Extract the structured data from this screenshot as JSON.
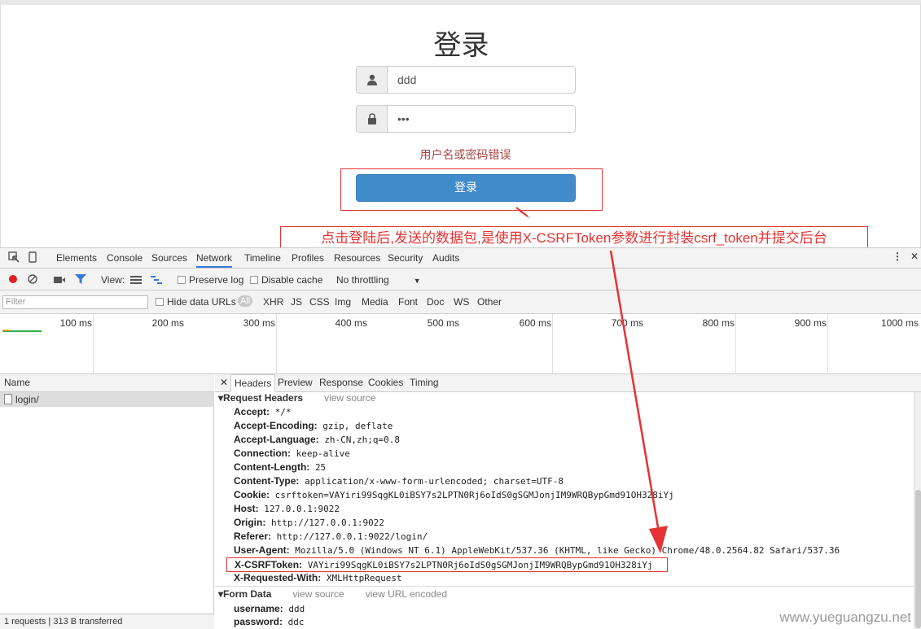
{
  "login": {
    "title": "登录",
    "username_value": "ddd",
    "password_value": "•••",
    "error": "用户名或密码错误",
    "submit_label": "登录"
  },
  "annotation": "点击登陆后,发送的数据包,是使用X-CSRFToken参数进行封装csrf_token并提交后台",
  "devtools": {
    "tabs": [
      "Elements",
      "Console",
      "Sources",
      "Network",
      "Timeline",
      "Profiles",
      "Resources",
      "Security",
      "Audits"
    ],
    "active_tab": "Network",
    "toolbar": {
      "view_label": "View:",
      "preserve_log": "Preserve log",
      "disable_cache": "Disable cache",
      "throttling": "No throttling"
    },
    "filter": {
      "placeholder": "Filter",
      "hide_data_urls": "Hide data URLs",
      "types": [
        "All",
        "XHR",
        "JS",
        "CSS",
        "Img",
        "Media",
        "Font",
        "Doc",
        "WS",
        "Other"
      ]
    },
    "timeline_labels": [
      "100 ms",
      "200 ms",
      "300 ms",
      "400 ms",
      "500 ms",
      "600 ms",
      "700 ms",
      "800 ms",
      "900 ms",
      "1000 ms"
    ],
    "name_header": "Name",
    "requests": [
      "login/"
    ],
    "status": "1 requests  |  313 B transferred",
    "detail_tabs": [
      "Headers",
      "Preview",
      "Response",
      "Cookies",
      "Timing"
    ],
    "request_headers_title": "Request Headers",
    "view_source": "view source",
    "headers": [
      {
        "k": "Accept:",
        "v": "*/*"
      },
      {
        "k": "Accept-Encoding:",
        "v": "gzip, deflate"
      },
      {
        "k": "Accept-Language:",
        "v": "zh-CN,zh;q=0.8"
      },
      {
        "k": "Connection:",
        "v": "keep-alive"
      },
      {
        "k": "Content-Length:",
        "v": "25"
      },
      {
        "k": "Content-Type:",
        "v": "application/x-www-form-urlencoded; charset=UTF-8"
      },
      {
        "k": "Cookie:",
        "v": "csrftoken=VAYiri99SqgKL0iBSY7s2LPTN0Rj6oIdS0gSGMJonjIM9WRQBypGmd91OH328iYj"
      },
      {
        "k": "Host:",
        "v": "127.0.0.1:9022"
      },
      {
        "k": "Origin:",
        "v": "http://127.0.0.1:9022"
      },
      {
        "k": "Referer:",
        "v": "http://127.0.0.1:9022/login/"
      },
      {
        "k": "User-Agent:",
        "v": "Mozilla/5.0 (Windows NT 6.1) AppleWebKit/537.36 (KHTML, like Gecko) Chrome/48.0.2564.82 Safari/537.36"
      },
      {
        "k": "X-CSRFToken:",
        "v": "VAYiri99SqgKL0iBSY7s2LPTN0Rj6oIdS0gSGMJonjIM9WRQBypGmd91OH328iYj"
      },
      {
        "k": "X-Requested-With:",
        "v": "XMLHttpRequest"
      }
    ],
    "form_data_title": "Form Data",
    "view_url_encoded": "view URL encoded",
    "form_data": [
      {
        "k": "username:",
        "v": "ddd"
      },
      {
        "k": "password:",
        "v": "ddc"
      }
    ]
  },
  "watermark": "www.yueguangzu.net",
  "colors": {
    "accent": "#428bca",
    "error": "#a94442",
    "annotation": "#e53333",
    "devtools_active": "#3879d9"
  }
}
